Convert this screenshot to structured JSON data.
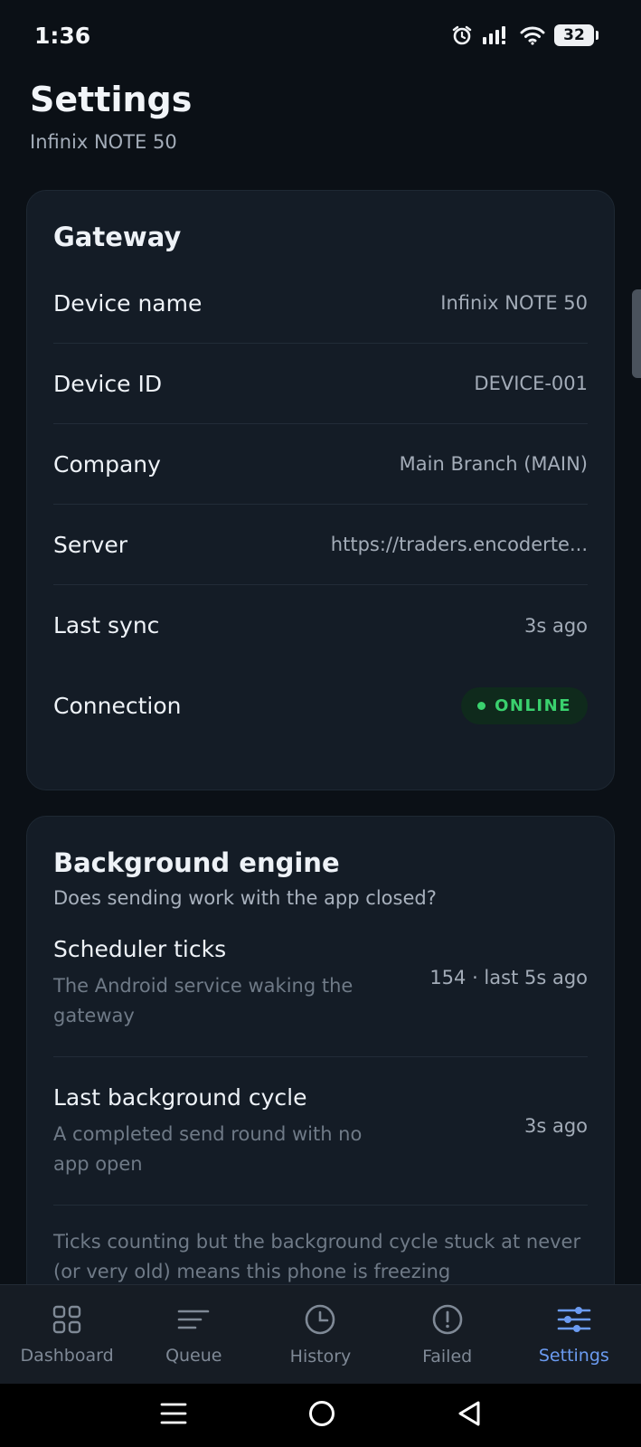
{
  "status_bar": {
    "time": "1:36",
    "battery": "32",
    "icons": [
      "alarm-icon",
      "signal-icon",
      "wifi-icon",
      "battery-icon"
    ]
  },
  "header": {
    "title": "Settings",
    "subtitle": "Infinix NOTE 50"
  },
  "gateway": {
    "title": "Gateway",
    "rows": [
      {
        "label": "Device name",
        "value": "Infinix NOTE 50"
      },
      {
        "label": "Device ID",
        "value": "DEVICE-001"
      },
      {
        "label": "Company",
        "value": "Main Branch (MAIN)"
      },
      {
        "label": "Server",
        "value": "https://traders.encoderte..."
      },
      {
        "label": "Last sync",
        "value": "3s ago"
      }
    ],
    "connection": {
      "label": "Connection",
      "status": "ONLINE",
      "color": "#3ad16e"
    }
  },
  "engine": {
    "title": "Background engine",
    "description": "Does sending work with the app closed?",
    "rows": [
      {
        "title": "Scheduler ticks",
        "subtitle": "The Android service waking the gateway",
        "value": "154 · last 5s ago"
      },
      {
        "title": "Last background cycle",
        "subtitle": "A completed send round with no app open",
        "value": "3s ago"
      }
    ],
    "note": "Ticks counting but the background cycle stuck at never (or very old) means this phone is freezing"
  },
  "bottom_nav": {
    "items": [
      {
        "label": "Dashboard",
        "icon": "grid-icon"
      },
      {
        "label": "Queue",
        "icon": "list-icon"
      },
      {
        "label": "History",
        "icon": "clock-icon"
      },
      {
        "label": "Failed",
        "icon": "alert-circle-icon"
      },
      {
        "label": "Settings",
        "icon": "sliders-icon",
        "active": true
      }
    ],
    "active_color": "#6b9bf1"
  },
  "system_nav": [
    "menu-icon",
    "home-icon",
    "back-icon"
  ]
}
